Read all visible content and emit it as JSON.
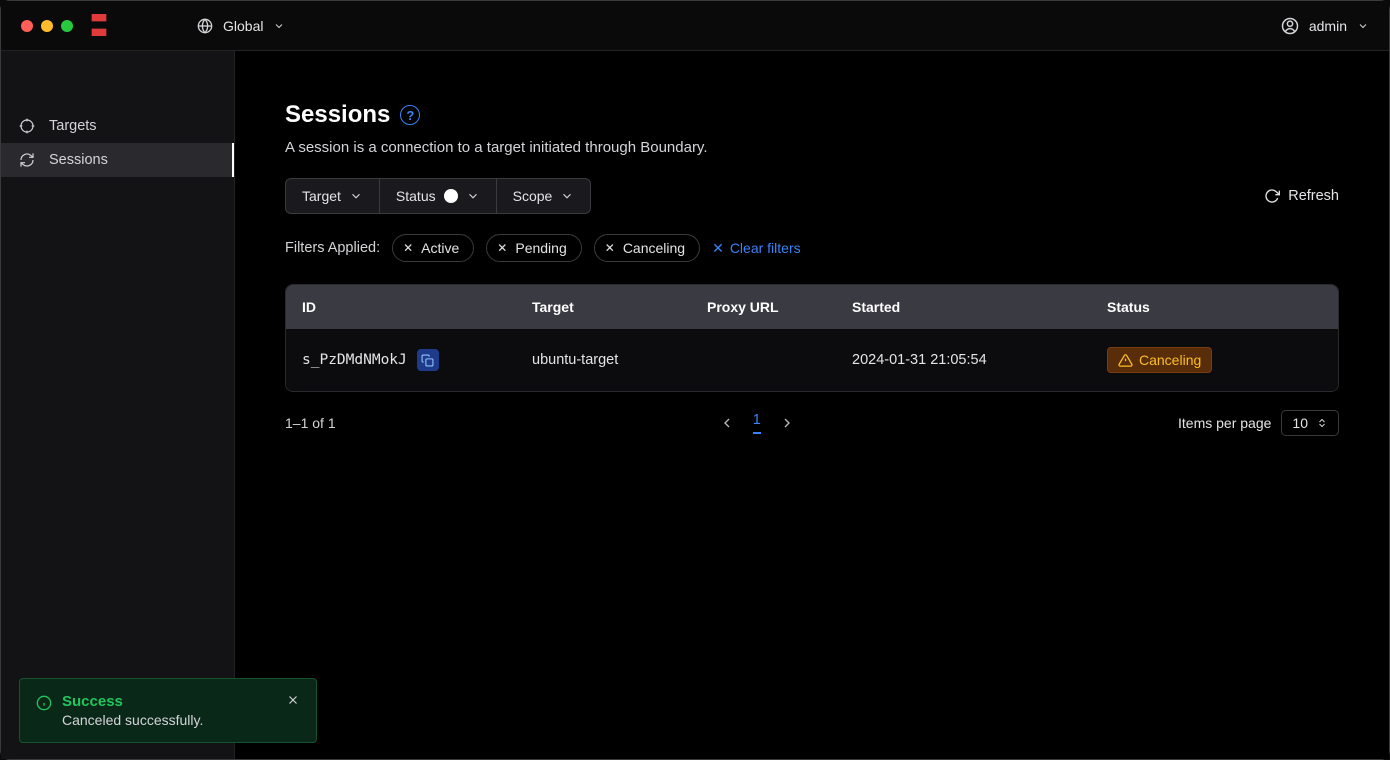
{
  "header": {
    "scope_label": "Global",
    "user_label": "admin"
  },
  "sidebar": {
    "items": [
      {
        "label": "Targets"
      },
      {
        "label": "Sessions"
      }
    ]
  },
  "page": {
    "title": "Sessions",
    "description": "A session is a connection to a target initiated through Boundary.",
    "refresh_label": "Refresh"
  },
  "filter_buttons": {
    "target": "Target",
    "status": "Status",
    "scope": "Scope"
  },
  "filters": {
    "applied_label": "Filters Applied:",
    "chips": [
      "Active",
      "Pending",
      "Canceling"
    ],
    "clear_label": "Clear filters"
  },
  "table": {
    "headers": [
      "ID",
      "Target",
      "Proxy URL",
      "Started",
      "Status"
    ],
    "rows": [
      {
        "id": "s_PzDMdNMokJ",
        "target": "ubuntu-target",
        "proxy_url": "",
        "started": "2024-01-31 21:05:54",
        "status": "Canceling"
      }
    ]
  },
  "pagination": {
    "range": "1–1 of 1",
    "current_page": "1",
    "items_per_page_label": "Items per page",
    "items_per_page_value": "10"
  },
  "toast": {
    "title": "Success",
    "message": "Canceled successfully."
  }
}
